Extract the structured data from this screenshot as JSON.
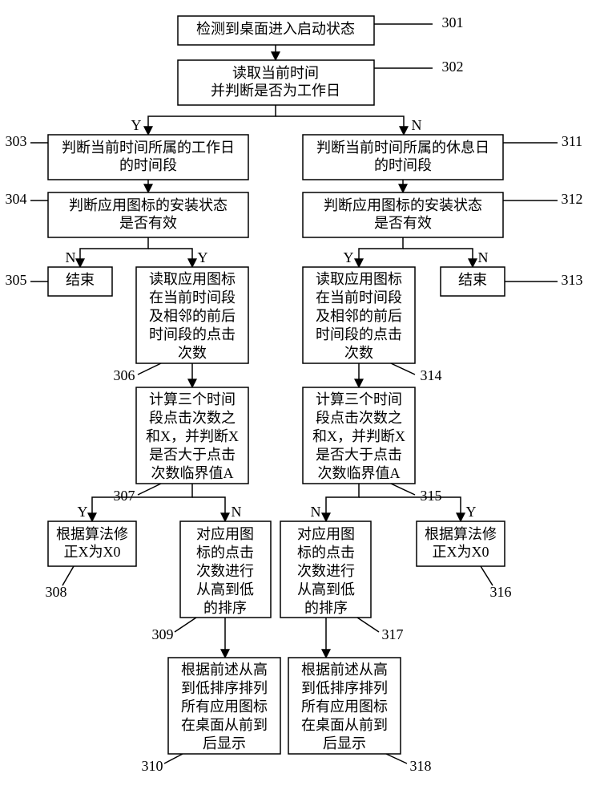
{
  "nodes": {
    "n301": {
      "num": "301",
      "lines": [
        "检测到桌面进入启动状态"
      ]
    },
    "n302": {
      "num": "302",
      "lines": [
        "读取当前时间",
        "并判断是否为工作日"
      ]
    },
    "n303": {
      "num": "303",
      "lines": [
        "判断当前时间所属的工作日",
        "的时间段"
      ]
    },
    "n304": {
      "num": "304",
      "lines": [
        "判断应用图标的安装状态",
        "是否有效"
      ]
    },
    "n305": {
      "num": "305",
      "lines": [
        "结束"
      ]
    },
    "n306": {
      "num": "306",
      "lines": [
        "读取应用图标",
        "在当前时间段",
        "及相邻的前后",
        "时间段的点击",
        "次数"
      ]
    },
    "n307": {
      "num": "307",
      "lines": [
        "计算三个时间",
        "段点击次数之",
        "和X，并判断X",
        "是否大于点击",
        "次数临界值A"
      ]
    },
    "n308": {
      "num": "308",
      "lines": [
        "根据算法修",
        "正X为X0"
      ]
    },
    "n309": {
      "num": "309",
      "lines": [
        "对应用图",
        "标的点击",
        "次数进行",
        "从高到低",
        "的排序"
      ]
    },
    "n310": {
      "num": "310",
      "lines": [
        "根据前述从高",
        "到低排序排列",
        "所有应用图标",
        "在桌面从前到",
        "后显示"
      ]
    },
    "n311": {
      "num": "311",
      "lines": [
        "判断当前时间所属的休息日",
        "的时间段"
      ]
    },
    "n312": {
      "num": "312",
      "lines": [
        "判断应用图标的安装状态",
        "是否有效"
      ]
    },
    "n313": {
      "num": "313",
      "lines": [
        "结束"
      ]
    },
    "n314": {
      "num": "314",
      "lines": [
        "读取应用图标",
        "在当前时间段",
        "及相邻的前后",
        "时间段的点击",
        "次数"
      ]
    },
    "n315": {
      "num": "315",
      "lines": [
        "计算三个时间",
        "段点击次数之",
        "和X，并判断X",
        "是否大于点击",
        "次数临界值A"
      ]
    },
    "n316": {
      "num": "316",
      "lines": [
        "根据算法修",
        "正X为X0"
      ]
    },
    "n317": {
      "num": "317",
      "lines": [
        "对应用图",
        "标的点击",
        "次数进行",
        "从高到低",
        "的排序"
      ]
    },
    "n318": {
      "num": "318",
      "lines": [
        "根据前述从高",
        "到低排序排列",
        "所有应用图标",
        "在桌面从前到",
        "后显示"
      ]
    }
  },
  "branchLabels": {
    "yes": "Y",
    "no": "N"
  }
}
